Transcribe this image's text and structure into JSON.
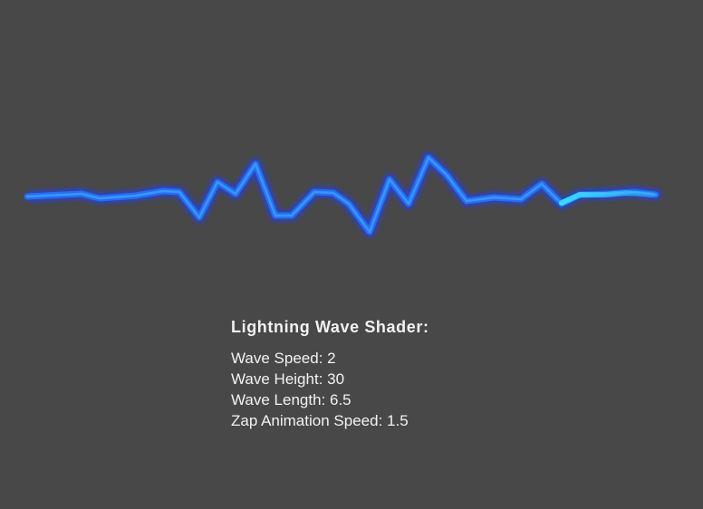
{
  "panel": {
    "title": "Lightning Wave Shader:",
    "params": [
      {
        "label": "Wave Speed",
        "value": "2"
      },
      {
        "label": "Wave Height",
        "value": "30"
      },
      {
        "label": "Wave Length",
        "value": "6.5"
      },
      {
        "label": "Zap Animation Speed",
        "value": "1.5"
      }
    ]
  },
  "colors": {
    "background": "#484848",
    "wave_main": "#1f6fff",
    "wave_glow": "#2a3fd8",
    "wave_core": "#3fa0ff",
    "zap_highlight": "#35e8ff",
    "text": "#f2f2f2"
  }
}
